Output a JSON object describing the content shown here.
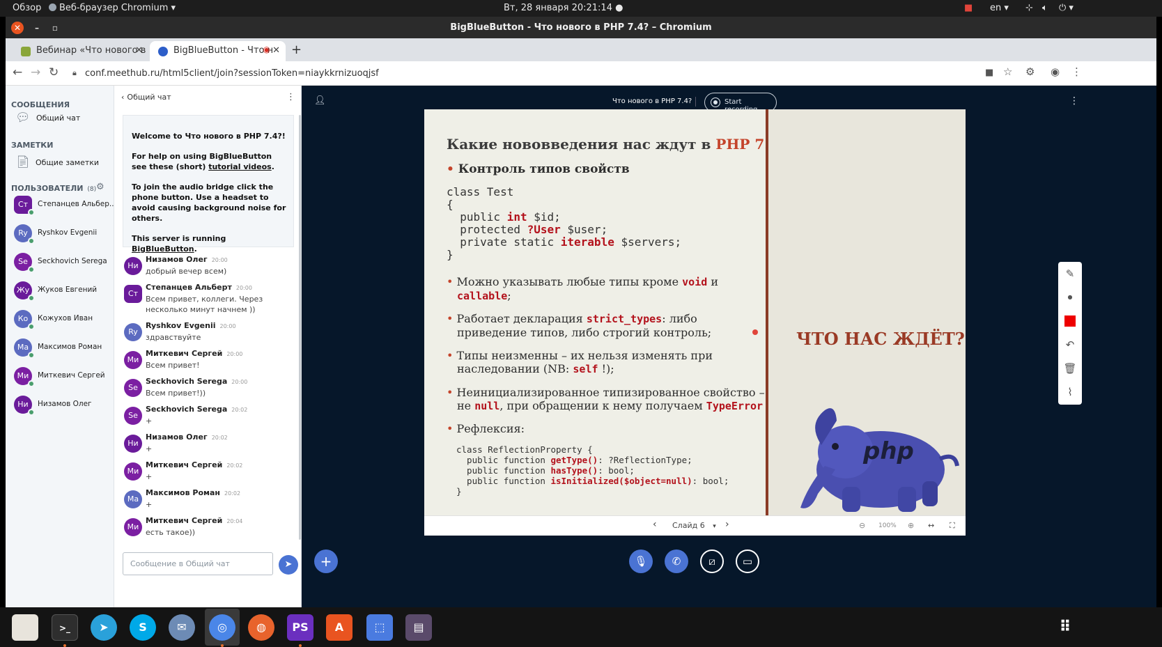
{
  "system_bar": {
    "overview": "Обзор",
    "app_menu": "Веб-браузер Chromium",
    "clock": "Вт, 28 января  20:21:14",
    "lang": "en"
  },
  "window": {
    "title": "BigBlueButton - Что нового в PHP 7.4? – Chromium"
  },
  "tabs": [
    {
      "label": "Вебинар «Что нового в Р",
      "icon_color": "#8aa63a"
    },
    {
      "label": "BigBlueButton - Что н",
      "icon_color": "#2d5ec9"
    }
  ],
  "address": {
    "url": "conf.meethub.ru/html5client/join?sessionToken=niaykkrnizuoqjsf"
  },
  "left_panel": {
    "messages_title": "СООБЩЕНИЯ",
    "public_chat": "Общий чат",
    "notes_title": "ЗАМЕТКИ",
    "shared_notes": "Общие заметки",
    "users_title": "ПОЛЬЗОВАТЕЛИ",
    "users_count": "(8)",
    "users": [
      {
        "initials": "Ст",
        "name": "Степанцев Альбер...",
        "color": "#6a1b9a",
        "presenter": true
      },
      {
        "initials": "Ry",
        "name": "Ryshkov Evgenii",
        "color": "#5c6bc0",
        "presenter": false
      },
      {
        "initials": "Se",
        "name": "Seckhovich Serega",
        "color": "#7b1fa2",
        "presenter": false
      },
      {
        "initials": "Жу",
        "name": "Жуков Евгений",
        "color": "#6a1b9a",
        "presenter": false
      },
      {
        "initials": "Ко",
        "name": "Кожухов Иван",
        "color": "#5c6bc0",
        "presenter": false
      },
      {
        "initials": "Ма",
        "name": "Максимов Роман",
        "color": "#5c6bc0",
        "presenter": false
      },
      {
        "initials": "Ми",
        "name": "Миткевич Сергей",
        "color": "#7b1fa2",
        "presenter": false
      },
      {
        "initials": "Ни",
        "name": "Низамов Олег",
        "color": "#6a1b9a",
        "presenter": false
      }
    ]
  },
  "chat": {
    "header": "Общий чат",
    "welcome": {
      "line1_prefix": "Welcome to ",
      "line1_title": "Что нового в PHP 7.4?",
      "line1_suffix": "!",
      "help_prefix": "For help on using BigBlueButton see these (short) ",
      "help_link": "tutorial videos",
      "help_suffix": ".",
      "audio": "To join the audio bridge click the phone button. Use a headset to avoid causing background noise for others.",
      "server_prefix": "This server is running ",
      "server_link": "BigBlueButton",
      "server_suffix": "."
    },
    "messages": [
      {
        "initials": "Ни",
        "color": "#6a1b9a",
        "name": "Низамов Олег",
        "time": "20:00",
        "text": "добрый вечер всем)"
      },
      {
        "initials": "Ст",
        "color": "#6a1b9a",
        "name": "Степанцев Альберт",
        "time": "20:00",
        "text": "Всем привет, коллеги. Через несколько минут начнем ))"
      },
      {
        "initials": "Ry",
        "color": "#5c6bc0",
        "name": "Ryshkov Evgenii",
        "time": "20:00",
        "text": "здравствуйте"
      },
      {
        "initials": "Ми",
        "color": "#7b1fa2",
        "name": "Миткевич Сергей",
        "time": "20:00",
        "text": "Всем привет!"
      },
      {
        "initials": "Se",
        "color": "#7b1fa2",
        "name": "Seckhovich Serega",
        "time": "20:00",
        "text": "Всем привет!))"
      },
      {
        "initials": "Se",
        "color": "#7b1fa2",
        "name": "Seckhovich Serega",
        "time": "20:02",
        "text": "+"
      },
      {
        "initials": "Ни",
        "color": "#6a1b9a",
        "name": "Низамов Олег",
        "time": "20:02",
        "text": "+"
      },
      {
        "initials": "Ми",
        "color": "#7b1fa2",
        "name": "Миткевич Сергей",
        "time": "20:02",
        "text": "+"
      },
      {
        "initials": "Ма",
        "color": "#5c6bc0",
        "name": "Максимов Роман",
        "time": "20:02",
        "text": "+"
      },
      {
        "initials": "Ми",
        "color": "#7b1fa2",
        "name": "Миткевич Сергей",
        "time": "20:04",
        "text": "есть такое))"
      }
    ],
    "input_placeholder": "Сообщение в Общий чат"
  },
  "stage": {
    "meeting_title": "Что нового в PHP 7.4?",
    "record_label": "Start recording",
    "slide_label": "Слайд 6",
    "zoom": "100%"
  },
  "slide": {
    "heading_prefix": "Какие нововведения нас ждут в ",
    "heading_php": "PHP 7.4",
    "heading_suffix": "?",
    "b1": "Контроль типов свойств",
    "code1": [
      "class Test",
      "{",
      "}"
    ],
    "code1_l1": [
      "  public ",
      "int",
      " $id;"
    ],
    "code1_l2": [
      "  protected ",
      "?User",
      " $user;"
    ],
    "code1_l3": [
      "  private static ",
      "iterable",
      " $servers;"
    ],
    "b2_a": "Можно указывать любые типы кроме ",
    "b2_void": "void",
    "b2_and": " и",
    "b2_callable": "callable",
    "b2_end": ";",
    "b3_a": "Работает декларация ",
    "b3_strict": "strict_types",
    "b3_b": ": либо",
    "b3_c": "приведение типов, либо строгий контроль;",
    "b4_a": "Типы неизменны – их нельзя изменять при",
    "b4_b": "наследовании (NB: ",
    "b4_self": "self",
    "b4_c": " !);",
    "b5_a": "Неинициализированное типизированное свойство –",
    "b5_b": "не ",
    "b5_null": "null",
    "b5_c": ", при обращении к нему получаем ",
    "b5_type": "TypeError",
    "b6": "Рефлексия:",
    "code2_0": "class ReflectionProperty {",
    "code2_1": [
      "  public function ",
      "getType()",
      ": ?ReflectionType;"
    ],
    "code2_2": [
      "  public function ",
      "hasType()",
      ": bool;"
    ],
    "code2_3": [
      "  public function ",
      "isInitialized($object=null)",
      ": bool;"
    ],
    "code2_4": "}",
    "right_title": "ЧТО НАС ЖДЁТ?",
    "logo_text": "php"
  },
  "colors": {
    "stage_bg": "#06172a",
    "accent": "#4a73d3",
    "brand_red": "#8b3b26"
  }
}
